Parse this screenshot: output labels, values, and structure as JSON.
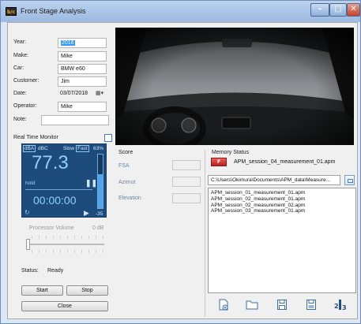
{
  "window": {
    "title": "Front Stage Analysis",
    "app_icon_text": "b/c"
  },
  "form": {
    "year_label": "Year:",
    "year_value": "2018",
    "make_label": "Make:",
    "make_value": "Mike",
    "car_label": "Car:",
    "car_value": "BMW e60",
    "customer_label": "Customer:",
    "customer_value": "Jim",
    "date_label": "Date:",
    "date_value": "03/07/2018",
    "operator_label": "Operator:",
    "operator_value": "Mike",
    "note_label": "Note:",
    "note_value": ""
  },
  "monitor": {
    "title": "Real Time Monitor",
    "dba": "dBA",
    "dbc": "dBC",
    "slow": "Slow",
    "fast": "Fast",
    "percent": "63%",
    "value": "77.3",
    "hold": "hold",
    "time": "00:00:00",
    "min_db": "-35",
    "level_fraction": 0.63
  },
  "processor": {
    "label": "Processor Volume",
    "db": "0 dB"
  },
  "status": {
    "label": "Status:",
    "value": "Ready"
  },
  "buttons": {
    "start": "Start",
    "stop": "Stop",
    "close": "Close"
  },
  "score": {
    "title": "Score",
    "fsa": "FSA",
    "azimut": "Azimut",
    "elevation": "Elevation"
  },
  "memory": {
    "title": "Memory Status",
    "rec_badge": "F",
    "current_file": "APM_session_04_measurement_01.apm",
    "path": "C:\\Users\\Okimura\\Documents\\APM_data\\Measure...",
    "files": [
      "APM_session_01_measurement_01.apm",
      "APM_session_02_measurement_01.apm",
      "APM_session_02_measurement_02.apm",
      "APM_session_03_measurement_01.apm"
    ]
  },
  "toolbar_icons": [
    "new-file-icon",
    "open-folder-icon",
    "save-icon",
    "save-as-icon",
    "sort-icon"
  ],
  "colors": {
    "monitor_bg": "#1c4b7c",
    "monitor_text": "#8fd0ff",
    "record": "#d12a2a",
    "title_bar": "#a8c3e6"
  }
}
